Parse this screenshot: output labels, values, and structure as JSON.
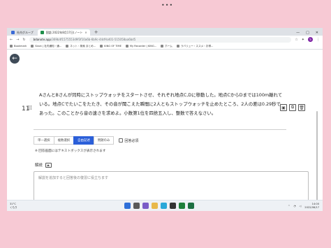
{
  "top_dots": "•••",
  "browser": {
    "tabs": [
      {
        "label": "社内グループ",
        "active": false
      },
      {
        "label": "国語 2022年8月17日(ノート",
        "active": true
      }
    ],
    "newtab": "+",
    "window_controls": [
      "—",
      "□",
      "✕"
    ],
    "url_host": "bdanote.app",
    "url_path": "/369b4f1575553d9f3f10a6b-6b9c-44df-b401-515058aa6bd5",
    "profile_initial": "S",
    "bookmarks": [
      "Bookmark",
      "Slack | 社内通知・通...",
      "ネット・検索 まとめ...",
      "KING OF TIME",
      "My Recorder | KING...",
      "ホーム",
      "ラバリュー・ススメ・お得..."
    ]
  },
  "question": {
    "number": "11",
    "drag": "⁞⁞",
    "text": "AさんとBさんが同時にストップウォッチをスタートさせ、それぞれ地点C,Dに移動した。地点CからDまでは100m離れている。地点Cでたいこをたたき、その音が聞こえた瞬間に2人ともストップウォッチを止めたところ、2人の差は0.29秒であった。このことから音の速さを求めよ。小数第1位を四捨五入し、整数で答えなさい。"
  },
  "answer_types": {
    "tabs": [
      {
        "label": "単一選択",
        "active": false
      },
      {
        "label": "複数選択",
        "active": false
      },
      {
        "label": "自由記述",
        "active": true
      },
      {
        "label": "問題のみ",
        "active": false
      }
    ],
    "required_label": "回答必須"
  },
  "note": "※ 回答画面にはテキストボックスが表示されます",
  "explanation": {
    "label": "解説",
    "placeholder": "解説を追加すると回答後の復習に役立ちます"
  },
  "taskbar": {
    "weather_temp": "31°C",
    "weather_desc": "くもり",
    "time": "14:00",
    "date": "2022/08/17"
  }
}
